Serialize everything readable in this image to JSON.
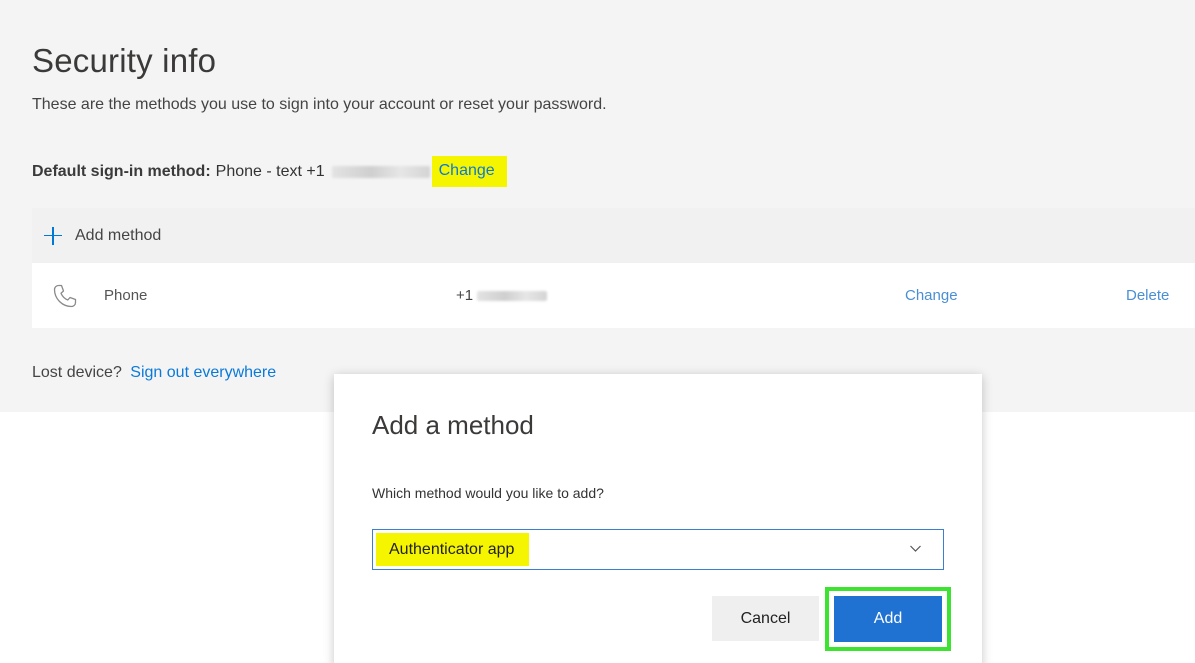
{
  "page": {
    "title": "Security info",
    "subtitle": "These are the methods you use to sign into your account or reset your password."
  },
  "default_method": {
    "label": "Default sign-in method:",
    "value": "Phone - text +1",
    "change_link": "Change",
    "highlight_color": "#f5f500"
  },
  "methods": {
    "add_label": "Add method",
    "rows": [
      {
        "icon": "phone-icon",
        "type": "Phone",
        "number_prefix": "+1",
        "change": "Change",
        "delete": "Delete"
      }
    ]
  },
  "lost_device": {
    "text": "Lost device?",
    "link": "Sign out everywhere"
  },
  "dialog": {
    "title": "Add a method",
    "question": "Which method would you like to add?",
    "selected_method": "Authenticator app",
    "cancel_label": "Cancel",
    "add_label": "Add",
    "add_highlight_color": "#3ce330",
    "accent_color": "#1f72d2"
  }
}
